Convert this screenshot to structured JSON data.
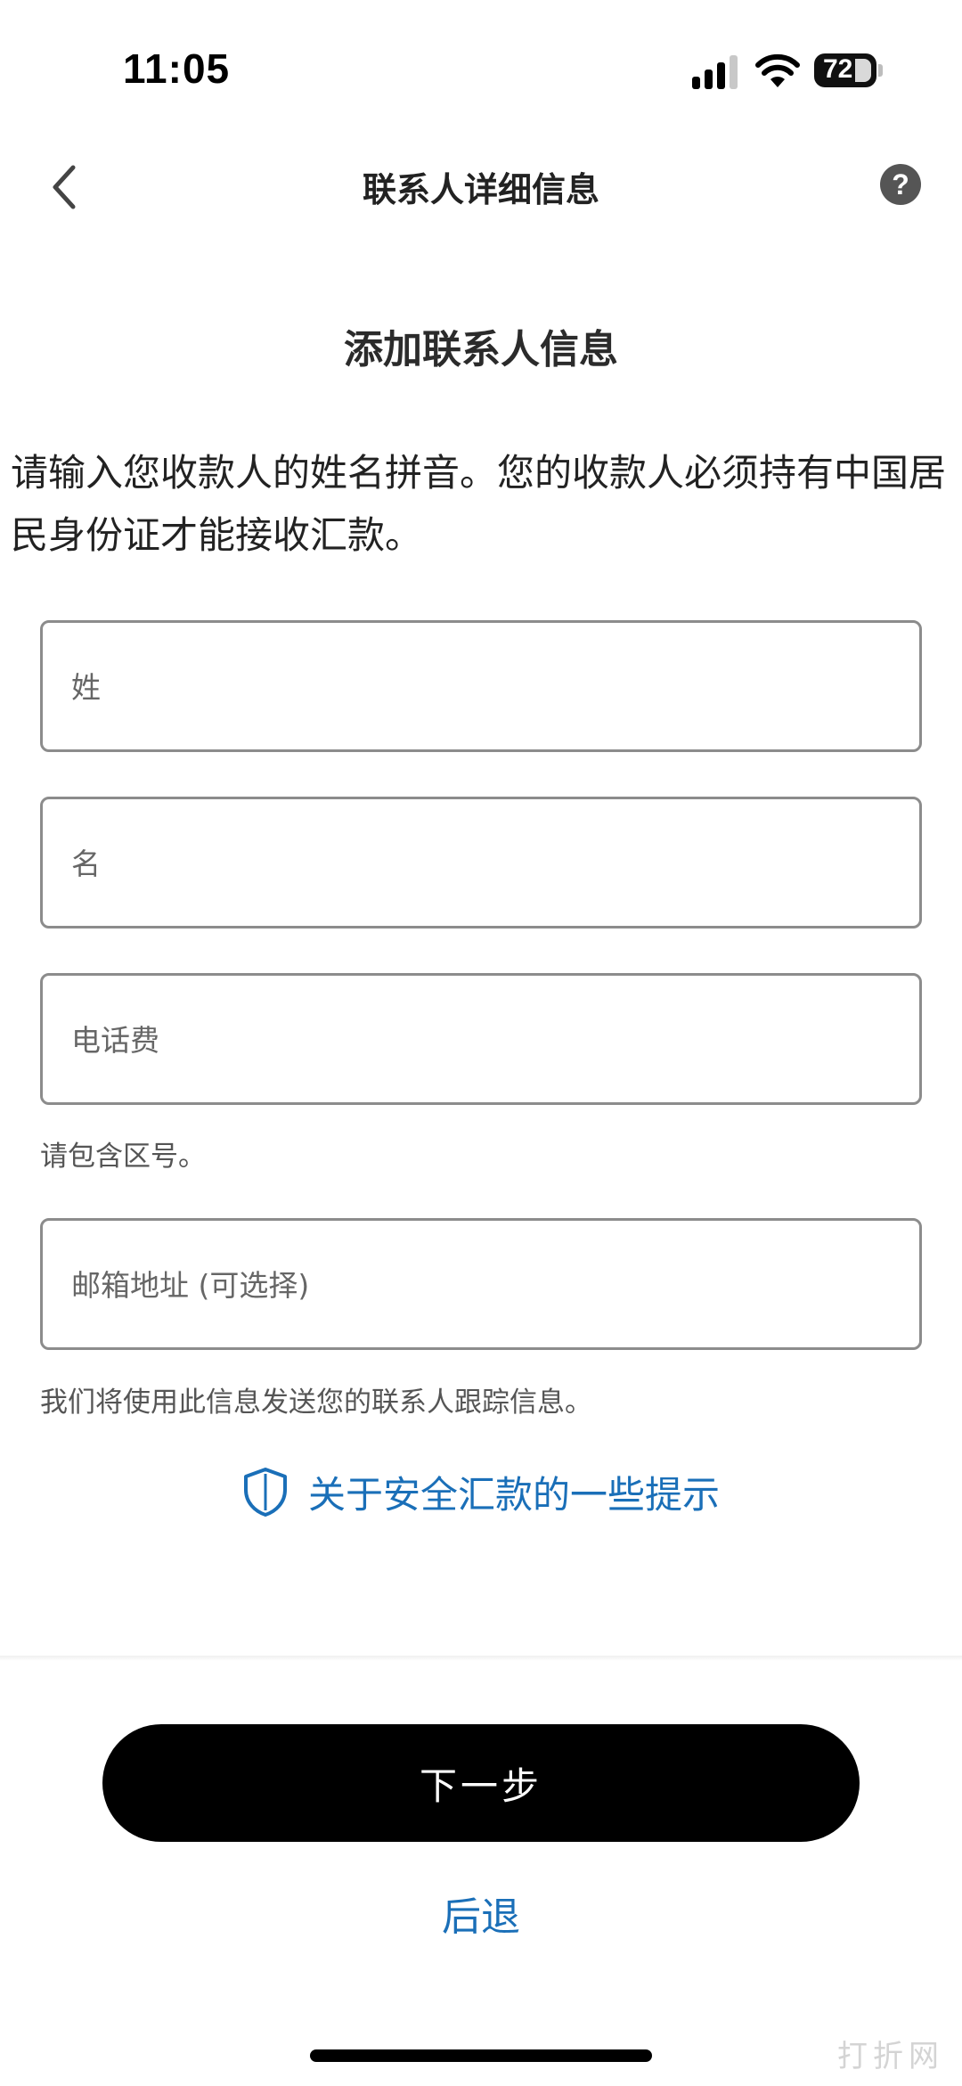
{
  "status_bar": {
    "time": "11:05",
    "battery": "72"
  },
  "nav": {
    "title": "联系人详细信息",
    "help_icon": "?"
  },
  "section_title": "添加联系人信息",
  "intro": "请输入您收款人的姓名拼音。您的收款人必须持有中国居民身份证才能接收汇款。",
  "form": {
    "last_name_placeholder": "姓",
    "first_name_placeholder": "名",
    "phone_placeholder": "电话费",
    "phone_hint": "请包含区号。",
    "email_placeholder": "邮箱地址 (可选择)",
    "email_hint": "我们将使用此信息发送您的联系人跟踪信息。"
  },
  "tips_link": "关于安全汇款的一些提示",
  "buttons": {
    "next": "下一步",
    "back": "后退"
  },
  "watermark": "打折网",
  "colors": {
    "link": "#1a6fb8",
    "primary_button": "#000000",
    "border": "#8c8c8c"
  }
}
